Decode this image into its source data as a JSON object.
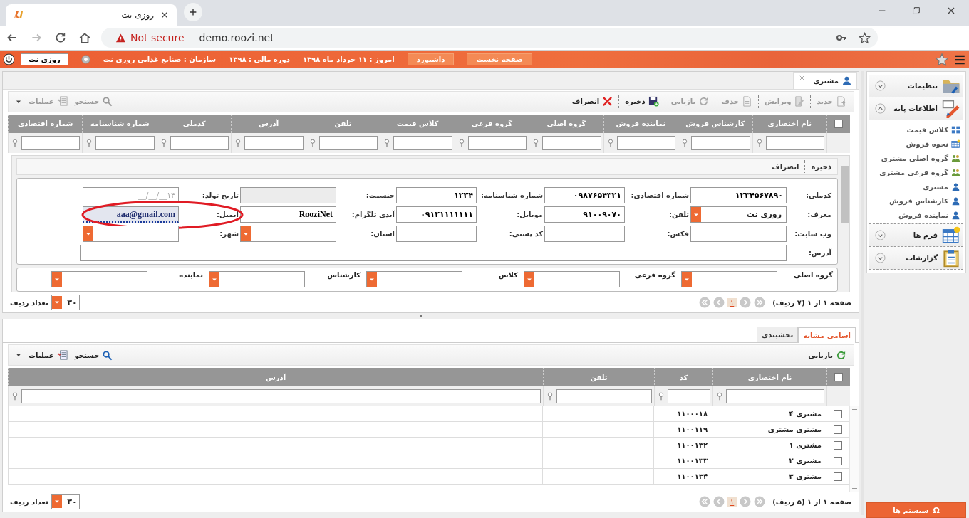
{
  "browser": {
    "tab_title": "روزی نت",
    "security": "Not secure",
    "url": "demo.roozi.net"
  },
  "header": {
    "nav_buttons": [
      "صفحه نخست",
      "داشبورد"
    ],
    "info": [
      "امروز : ۱۱ خرداد ماه ۱۳۹۸",
      "دوره مالی : ۱۳۹۸",
      "سازمان : صنایع غذایی روزی نت"
    ],
    "user_button": "روزی نت"
  },
  "main": {
    "tab": {
      "label": "مشتری"
    },
    "toolbar": [
      {
        "label": "جدید",
        "kind": "new",
        "disabled": true
      },
      {
        "label": "ویرایش",
        "kind": "edit",
        "disabled": true
      },
      {
        "label": "حذف",
        "kind": "delete",
        "disabled": true
      },
      {
        "label": "بازیابی",
        "kind": "restore",
        "disabled": true
      },
      {
        "label": "ذخیره",
        "kind": "save",
        "disabled": false
      },
      {
        "label": "انصراف",
        "kind": "cancel",
        "disabled": false
      }
    ],
    "toolbar_left": [
      {
        "label": "جستجو",
        "kind": "search",
        "disabled": true
      },
      {
        "label": "عملیات",
        "kind": "ops",
        "disabled": true
      }
    ],
    "all_checked": false,
    "columns": [
      "نام اختصاری",
      "کارشناس فروش",
      "نماینده فروش",
      "گروه اصلی",
      "گروه فرعی",
      "کلاس قیمت",
      "تلفن",
      "آدرس",
      "کدملی",
      "شماره شناسنامه",
      "شماره اقتصادی"
    ],
    "form": {
      "actions": [
        "ذخیره",
        "انصراف"
      ],
      "rows": [
        [
          {
            "label": "کدملی:",
            "kind": "text",
            "value": "۱۲۳۴۵۶۷۸۹۰"
          },
          {
            "label": "شماره اقتصادی:",
            "kind": "text",
            "value": "۰۹۸۷۶۵۴۳۲۱"
          },
          {
            "label": "شماره شناسنامه:",
            "kind": "text",
            "value": "۱۲۳۴"
          },
          {
            "label": "جنسیت:",
            "kind": "text",
            "disabled": true
          },
          {
            "label": "تاریخ تولد:",
            "kind": "text",
            "placeholder": "۱۳__/__/__"
          }
        ],
        [
          {
            "label": "معرف:",
            "kind": "select",
            "value": "روزی نت"
          },
          {
            "label": "تلفن:",
            "kind": "text",
            "value": "۹۱۰۰۹۰۷۰"
          },
          {
            "label": "موبایل:",
            "kind": "text",
            "value": "۰۹۱۲۱۱۱۱۱۱۱"
          },
          {
            "label": "آیدی تلگرام:",
            "kind": "text",
            "value": "RooziNet"
          },
          {
            "label": "ایمیل:",
            "kind": "text",
            "value": "aaa@gmail.com",
            "focused": true,
            "highlighted": true
          }
        ],
        [
          {
            "label": "وب سایت:",
            "kind": "text"
          },
          {
            "label": "فکس:",
            "kind": "text"
          },
          {
            "label": "کد پستی:",
            "kind": "text"
          },
          {
            "label": "استان:",
            "kind": "select"
          },
          {
            "label": "شهر:",
            "kind": "select"
          }
        ]
      ],
      "address": {
        "label": "آدرس:"
      },
      "groups": [
        "گروه اصلی",
        "گروه فرعی",
        "کلاس",
        "کارشناس",
        "نماینده"
      ]
    },
    "pager": {
      "summary": "صفحه ۱ از ۱ (۷ ردیف)",
      "page": "۱",
      "rows_label": "تعداد ردیف",
      "page_size": "۳۰"
    }
  },
  "lower": {
    "tabs": [
      {
        "label": "اسامی مشابه",
        "selected": true
      },
      {
        "label": "بخشبندی",
        "selected": false
      }
    ],
    "toolbar": [
      {
        "label": "بازیابی",
        "kind": "restore",
        "disabled": false
      }
    ],
    "toolbar_left": [
      {
        "label": "جستجو",
        "kind": "search",
        "disabled": false
      },
      {
        "label": "عملیات",
        "kind": "ops",
        "disabled": false
      }
    ],
    "all_checked": false,
    "columns": [
      "نام اختصاری",
      "کد",
      "تلفن",
      "آدرس"
    ],
    "rows": [
      {
        "name": "مشتری ۴",
        "code": "۱۱۰۰۰۱۸",
        "checked": false
      },
      {
        "name": "مشتری مشتری",
        "code": "۱۱۰۰۱۱۹",
        "checked": false
      },
      {
        "name": "مشتری ۱",
        "code": "۱۱۰۰۱۳۲",
        "checked": false
      },
      {
        "name": "مشتری ۲",
        "code": "۱۱۰۰۱۳۳",
        "checked": false
      },
      {
        "name": "مشتری ۳",
        "code": "۱۱۰۰۱۳۴",
        "checked": false
      }
    ],
    "pager": {
      "summary": "صفحه ۱ از ۱ (۵ ردیف)",
      "page": "۱",
      "rows_label": "تعداد ردیف",
      "page_size": "۳۰"
    }
  },
  "sidebar": {
    "sections": [
      {
        "title": "تنظیمات",
        "kind": "folder",
        "expanded": false
      },
      {
        "title": "اطلاعات پایه",
        "kind": "pencil",
        "expanded": true,
        "children": [
          {
            "label": "کلاس قیمت",
            "kind": "grid"
          },
          {
            "label": "نحوه فروش",
            "kind": "table"
          },
          {
            "label": "گروه اصلی مشتری",
            "kind": "group"
          },
          {
            "label": "گروه فرعی مشتری",
            "kind": "group"
          },
          {
            "label": "مشتری",
            "kind": "user"
          },
          {
            "label": "کارشناس فروش",
            "kind": "user"
          },
          {
            "label": "نماینده فروش",
            "kind": "user"
          }
        ]
      },
      {
        "title": "فرم ها",
        "kind": "table",
        "expanded": false
      },
      {
        "title": "گزارشات",
        "kind": "clipboard",
        "expanded": false
      }
    ]
  },
  "system_button": {
    "glyph": "Ω",
    "label": "سیستم ها"
  }
}
